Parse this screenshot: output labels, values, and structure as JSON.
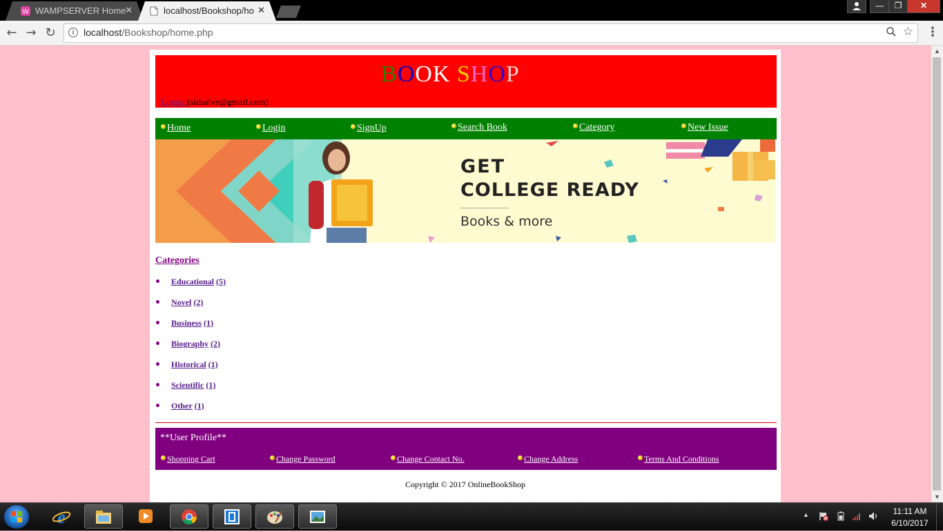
{
  "browser": {
    "tabs": [
      {
        "title": "WAMPSERVER Homepage",
        "active": false,
        "close": "✕"
      },
      {
        "title": "localhost/Bookshop/home.php",
        "active": true,
        "close": "✕"
      }
    ],
    "window_buttons": {
      "minimize": "—",
      "maximize": "❐",
      "close": "✕"
    },
    "url_host": "localhost",
    "url_path": "/Bookshop/home.php",
    "icons": [
      "back-arrow-icon",
      "forward-arrow-icon",
      "reload-icon",
      "info-icon",
      "zoom-icon",
      "star-icon",
      "menu-icon"
    ]
  },
  "header": {
    "brand_letters": [
      {
        "ch": "B",
        "color": "#2e7d00"
      },
      {
        "ch": "O",
        "color": "#0000cc"
      },
      {
        "ch": "O",
        "color": "#ffffff"
      },
      {
        "ch": "K",
        "color": "#ffffff"
      },
      {
        "ch": " ",
        "color": "#ffffff"
      },
      {
        "ch": "S",
        "color": "#ffcc00"
      },
      {
        "ch": "H",
        "color": "#ff66cc"
      },
      {
        "ch": "O",
        "color": "#3300cc"
      },
      {
        "ch": "P",
        "color": "#ffd0d0"
      }
    ],
    "logout_label": "Logout",
    "user_email": "(sidsalve@gmail.com)",
    "background": "#ff0000"
  },
  "nav": {
    "background": "#008000",
    "items": [
      "Home",
      "Login",
      "SignUp",
      "Search Book",
      "Category",
      "New Issue"
    ]
  },
  "banner": {
    "line1": "GET",
    "line2": "COLLEGE READY",
    "line3": "Books & more"
  },
  "categories": {
    "heading": "Categories",
    "items": [
      {
        "name": "Educational",
        "count": "(5)"
      },
      {
        "name": "Novel",
        "count": "(2)"
      },
      {
        "name": "Business",
        "count": "(1)"
      },
      {
        "name": "Biography",
        "count": "(2)"
      },
      {
        "name": "Historical",
        "count": "(1)"
      },
      {
        "name": "Scientific",
        "count": "(1)"
      },
      {
        "name": "Other",
        "count": "(1)"
      }
    ]
  },
  "profile": {
    "title": "**User Profile**",
    "background": "#800080",
    "links": [
      "Shopping Cart",
      "Change Password",
      "Change Contact No.",
      "Change Address",
      "Terms And Conditions"
    ]
  },
  "footer": {
    "copyright": "Copyright © 2017 OnlineBookShop"
  },
  "taskbar": {
    "apps": [
      "internet-explorer-icon",
      "file-explorer-icon",
      "media-player-icon",
      "chrome-icon",
      "app-icon",
      "paint-icon",
      "photos-icon"
    ],
    "time": "11:11 AM",
    "date": "6/10/2017"
  }
}
